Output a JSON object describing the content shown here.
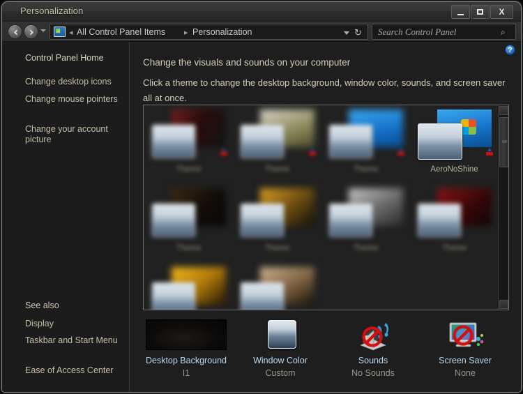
{
  "window": {
    "title": "Personalization",
    "controls": {
      "minimize_label": "",
      "maximize_label": "",
      "close_label": "X"
    }
  },
  "toolbar": {
    "back_icon": "back-arrow-icon",
    "forward_icon": "forward-arrow-icon",
    "recent_pages_icon": "chevron-down-icon",
    "address_icon": "control-panel-icon",
    "breadcrumbs": [
      {
        "label": "All Control Panel Items",
        "separator": "▸"
      },
      {
        "label": "Personalization",
        "separator": "▸"
      }
    ],
    "leading_separator": "◂",
    "address_dropdown_icon": "chevron-down-icon",
    "refresh_icon": "refresh-icon",
    "refresh_glyph": "↻"
  },
  "search": {
    "placeholder": "Search Control Panel",
    "value": "",
    "icon": "search-icon",
    "icon_glyph": "⌕"
  },
  "sidebar": {
    "home": "Control Panel Home",
    "items": [
      {
        "label": "Change desktop icons"
      },
      {
        "label": "Change mouse pointers"
      },
      {
        "label": "Change your account picture"
      }
    ],
    "see_also_heading": "See also",
    "see_also": [
      {
        "label": "Display"
      },
      {
        "label": "Taskbar and Start Menu"
      },
      {
        "label": "Ease of Access Center"
      }
    ]
  },
  "main": {
    "help_icon": "help-icon",
    "help_glyph": "?",
    "heading": "Change the visuals and sounds on your computer",
    "subtext": "Click a theme to change the desktop background, window color, sounds, and screen saver all at once."
  },
  "theme_grid": {
    "selected_theme": "AeroNoShine",
    "scrollbar": {
      "up_icon": "scroll-up-icon",
      "down_icon": "scroll-down-icon"
    },
    "themes": [
      {
        "label": "",
        "selected": false,
        "wall": "w-red",
        "badge": true,
        "row": 0,
        "col": 0
      },
      {
        "label": "",
        "selected": false,
        "wall": "w-olive",
        "badge": true,
        "row": 0,
        "col": 1
      },
      {
        "label": "",
        "selected": false,
        "wall": "w-blue",
        "badge": true,
        "row": 0,
        "col": 2
      },
      {
        "label": "AeroNoShine",
        "selected": true,
        "wall": "w-blue",
        "badge": true,
        "row": 0,
        "col": 3
      },
      {
        "label": "",
        "selected": false,
        "wall": "w-dark",
        "badge": false,
        "row": 1,
        "col": 0
      },
      {
        "label": "",
        "selected": false,
        "wall": "w-amber",
        "badge": false,
        "row": 1,
        "col": 1
      },
      {
        "label": "",
        "selected": false,
        "wall": "w-grey",
        "badge": false,
        "row": 1,
        "col": 2
      },
      {
        "label": "",
        "selected": false,
        "wall": "w-maroon",
        "badge": false,
        "row": 1,
        "col": 3
      },
      {
        "label": "",
        "selected": false,
        "wall": "w-gold",
        "badge": false,
        "row": 2,
        "col": 0
      },
      {
        "label": "",
        "selected": false,
        "wall": "w-sepia",
        "badge": false,
        "row": 2,
        "col": 1
      }
    ]
  },
  "theme_properties": [
    {
      "title": "Desktop Background",
      "value": "I1",
      "icon": "desktop-background-swatch"
    },
    {
      "title": "Window Color",
      "value": "Custom",
      "icon": "window-color-swatch"
    },
    {
      "title": "Sounds",
      "value": "No Sounds",
      "icon": "sounds-muted-icon"
    },
    {
      "title": "Screen Saver",
      "value": "None",
      "icon": "screen-saver-disabled-icon"
    }
  ],
  "annotation": {
    "arrow_color": "#e00000",
    "points_to": "AeroNoShine"
  },
  "colors": {
    "window_bg": "#1e1e1e",
    "titlebar_text": "#c9c0a8",
    "body_text": "#d4cdb9",
    "link_blue": "#bcd7f0",
    "accent_red": "#e00000"
  }
}
